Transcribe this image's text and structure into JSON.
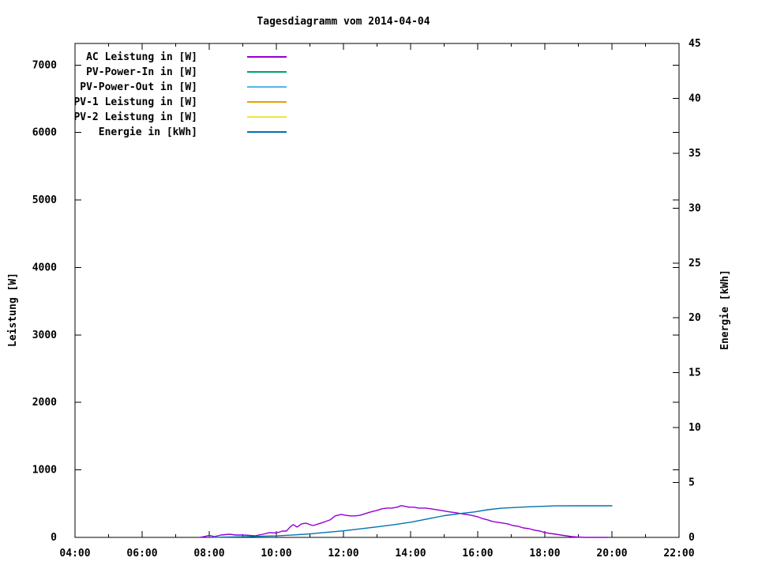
{
  "chart_data": {
    "type": "line",
    "title": "Tagesdiagramm vom 2014-04-04",
    "x_axis": {
      "range_hours": [
        4,
        22
      ],
      "major_tick_hours": [
        4,
        6,
        8,
        10,
        12,
        14,
        16,
        18,
        20,
        22
      ],
      "major_tick_labels": [
        "04:00",
        "06:00",
        "08:00",
        "10:00",
        "12:00",
        "14:00",
        "16:00",
        "18:00",
        "20:00",
        "22:00"
      ],
      "minor_tick_hours": [
        5,
        7,
        9,
        11,
        13,
        15,
        17,
        19,
        21
      ]
    },
    "y_left_axis": {
      "label": "Leistung [W]",
      "range": [
        0,
        7320
      ],
      "tick_values": [
        0,
        1000,
        2000,
        3000,
        4000,
        5000,
        6000,
        7000
      ],
      "tick_labels": [
        "0",
        "1000",
        "2000",
        "3000",
        "4000",
        "5000",
        "6000",
        "7000"
      ]
    },
    "y_right_axis": {
      "label": "Energie [kWh]",
      "range": [
        0,
        45
      ],
      "tick_values": [
        0,
        5,
        10,
        15,
        20,
        25,
        30,
        35,
        40,
        45
      ],
      "tick_labels": [
        "0",
        "5",
        "10",
        "15",
        "20",
        "25",
        "30",
        "35",
        "40",
        "45"
      ]
    },
    "legend_position": "top-left-inside",
    "grid": false,
    "series": [
      {
        "name": "AC Leistung in [W]",
        "color": "#9400d3",
        "axis": "left",
        "points": [
          [
            7.72,
            0
          ],
          [
            7.85,
            12
          ],
          [
            8.0,
            30
          ],
          [
            8.15,
            12
          ],
          [
            8.35,
            35
          ],
          [
            8.6,
            47
          ],
          [
            8.8,
            35
          ],
          [
            9.0,
            35
          ],
          [
            9.2,
            30
          ],
          [
            9.36,
            24
          ],
          [
            9.6,
            47
          ],
          [
            9.8,
            71
          ],
          [
            10.0,
            65
          ],
          [
            10.18,
            94
          ],
          [
            10.3,
            94
          ],
          [
            10.42,
            160
          ],
          [
            10.5,
            188
          ],
          [
            10.62,
            153
          ],
          [
            10.75,
            200
          ],
          [
            10.88,
            212
          ],
          [
            11.0,
            188
          ],
          [
            11.1,
            176
          ],
          [
            11.25,
            200
          ],
          [
            11.4,
            224
          ],
          [
            11.6,
            259
          ],
          [
            11.75,
            318
          ],
          [
            11.93,
            341
          ],
          [
            12.05,
            329
          ],
          [
            12.2,
            318
          ],
          [
            12.35,
            318
          ],
          [
            12.5,
            329
          ],
          [
            12.65,
            353
          ],
          [
            12.8,
            376
          ],
          [
            13.0,
            400
          ],
          [
            13.15,
            424
          ],
          [
            13.3,
            435
          ],
          [
            13.45,
            435
          ],
          [
            13.6,
            447
          ],
          [
            13.72,
            471
          ],
          [
            13.85,
            459
          ],
          [
            13.95,
            447
          ],
          [
            14.1,
            447
          ],
          [
            14.25,
            435
          ],
          [
            14.45,
            435
          ],
          [
            14.6,
            424
          ],
          [
            14.75,
            412
          ],
          [
            14.9,
            400
          ],
          [
            15.05,
            388
          ],
          [
            15.2,
            376
          ],
          [
            15.35,
            365
          ],
          [
            15.5,
            353
          ],
          [
            15.65,
            341
          ],
          [
            15.8,
            329
          ],
          [
            16.0,
            306
          ],
          [
            16.12,
            282
          ],
          [
            16.3,
            259
          ],
          [
            16.45,
            235
          ],
          [
            16.6,
            224
          ],
          [
            16.75,
            212
          ],
          [
            16.9,
            200
          ],
          [
            17.05,
            176
          ],
          [
            17.2,
            165
          ],
          [
            17.36,
            141
          ],
          [
            17.53,
            129
          ],
          [
            17.7,
            106
          ],
          [
            17.86,
            94
          ],
          [
            18.0,
            71
          ],
          [
            18.16,
            59
          ],
          [
            18.33,
            47
          ],
          [
            18.47,
            35
          ],
          [
            18.64,
            24
          ],
          [
            18.8,
            12
          ],
          [
            18.96,
            6
          ],
          [
            19.2,
            0
          ],
          [
            19.9,
            0
          ]
        ]
      },
      {
        "name": "PV-Power-In in [W]",
        "color": "#009e73",
        "axis": "left",
        "points": []
      },
      {
        "name": "PV-Power-Out in [W]",
        "color": "#56b4e9",
        "axis": "left",
        "points": []
      },
      {
        "name": "PV-1 Leistung in [W]",
        "color": "#e69f00",
        "axis": "left",
        "points": []
      },
      {
        "name": "PV-2 Leistung in [W]",
        "color": "#f0e442",
        "axis": "left",
        "points": []
      },
      {
        "name": "Energie in [kWh]",
        "color": "#0072b2",
        "axis": "right",
        "points": [
          [
            8.0,
            0
          ],
          [
            8.5,
            0.03
          ],
          [
            9.0,
            0.06
          ],
          [
            9.5,
            0.1
          ],
          [
            10.0,
            0.14
          ],
          [
            10.5,
            0.22
          ],
          [
            11.0,
            0.32
          ],
          [
            11.5,
            0.46
          ],
          [
            12.0,
            0.6
          ],
          [
            12.5,
            0.78
          ],
          [
            13.0,
            0.96
          ],
          [
            13.5,
            1.16
          ],
          [
            14.0,
            1.38
          ],
          [
            14.5,
            1.68
          ],
          [
            15.0,
            1.98
          ],
          [
            15.5,
            2.18
          ],
          [
            15.9,
            2.32
          ],
          [
            16.3,
            2.52
          ],
          [
            16.7,
            2.66
          ],
          [
            17.1,
            2.72
          ],
          [
            17.5,
            2.79
          ],
          [
            18.0,
            2.84
          ],
          [
            18.3,
            2.87
          ],
          [
            19.0,
            2.88
          ],
          [
            20.0,
            2.88
          ]
        ]
      }
    ]
  }
}
